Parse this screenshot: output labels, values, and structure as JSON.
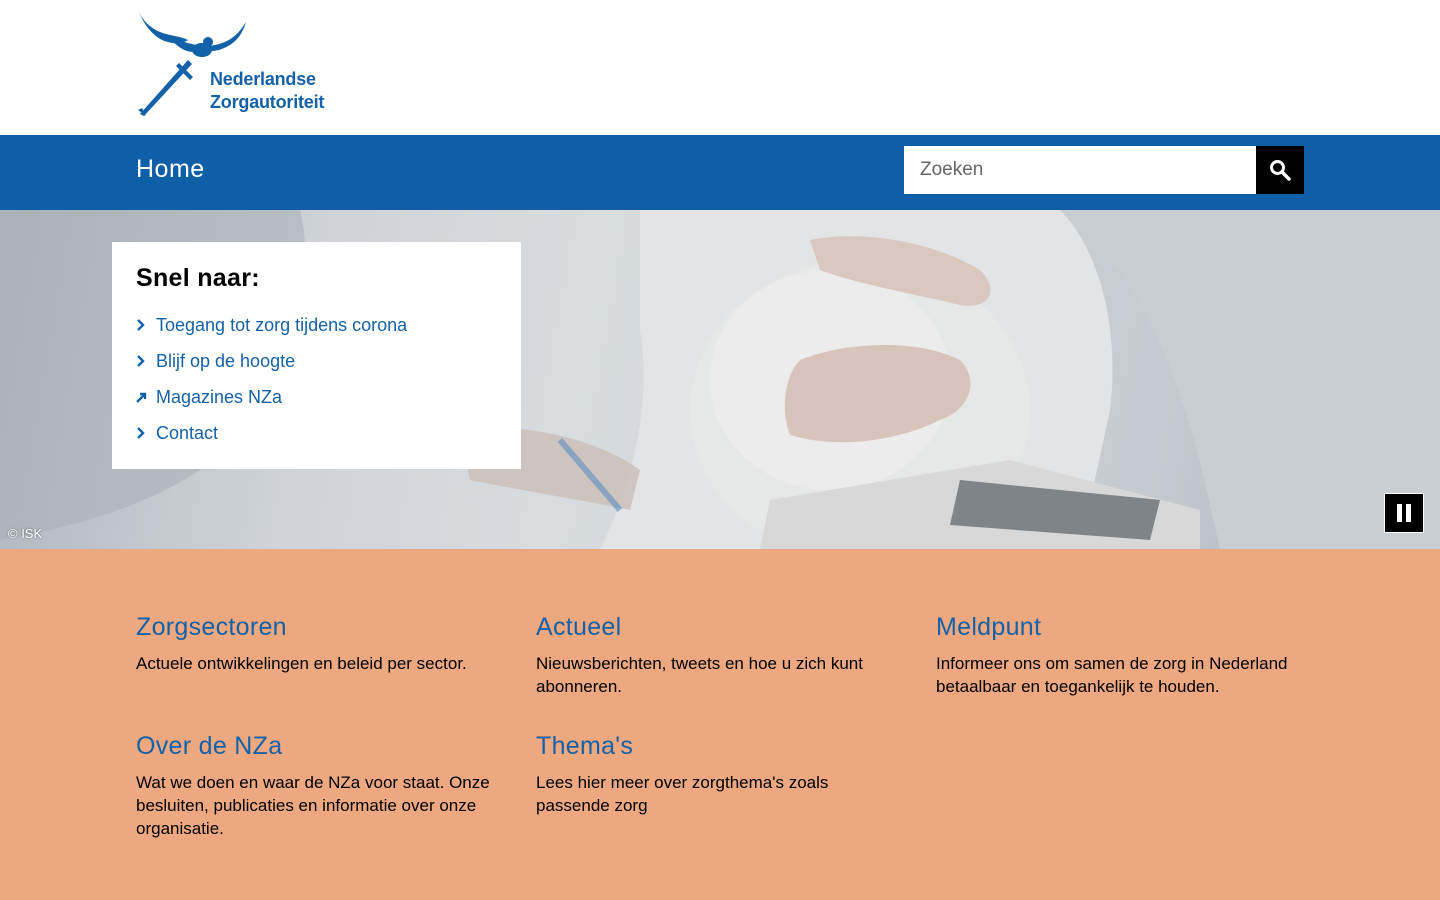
{
  "header": {
    "logo_line1": "Nederlandse",
    "logo_line2": "Zorgautoriteit"
  },
  "nav": {
    "home": "Home",
    "search_placeholder": "Zoeken"
  },
  "hero": {
    "quick_title": "Snel naar:",
    "quick_links": [
      {
        "label": "Toegang tot zorg tijdens corona",
        "icon": "chevron-right-icon"
      },
      {
        "label": "Blijf op de hoogte",
        "icon": "chevron-right-icon"
      },
      {
        "label": "Magazines NZa",
        "icon": "external-arrow-icon"
      },
      {
        "label": "Contact",
        "icon": "chevron-right-icon"
      }
    ],
    "credit": "© ISK"
  },
  "tiles": [
    {
      "title": "Zorgsectoren",
      "desc": "Actuele ontwikkelingen en beleid per sector."
    },
    {
      "title": "Actueel",
      "desc": "Nieuwsberichten, tweets en hoe u zich kunt abonneren."
    },
    {
      "title": "Meldpunt",
      "desc": "Informeer ons om samen de zorg in Nederland betaalbaar en toegankelijk te houden."
    },
    {
      "title": "Over de NZa",
      "desc": "Wat we doen en waar de NZa voor staat. Onze besluiten, publicaties en informatie over onze organisatie."
    },
    {
      "title": "Thema's",
      "desc": "Lees hier meer over zorgthema's zoals passende zorg"
    }
  ],
  "colors": {
    "brand_blue": "#0f5fa8",
    "link_blue": "#1361a9",
    "tiles_bg": "#eea87f"
  }
}
